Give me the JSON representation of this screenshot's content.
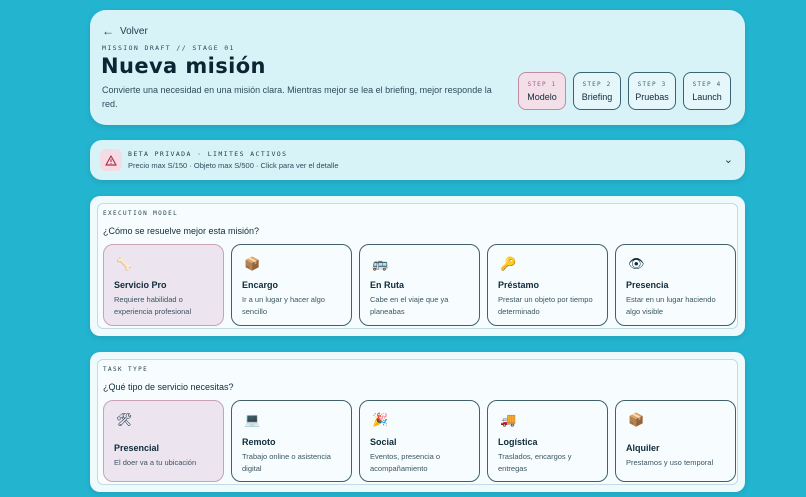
{
  "header": {
    "back_label": "Volver",
    "kicker": "MISSION DRAFT // STAGE 01",
    "title": "Nueva misión",
    "subtitle": "Convierte una necesidad en una misión clara. Mientras mejor se lea el briefing, mejor responde la red.",
    "steps": [
      {
        "number": "STEP 1",
        "label": "Modelo",
        "active": true
      },
      {
        "number": "STEP 2",
        "label": "Briefing",
        "active": false
      },
      {
        "number": "STEP 3",
        "label": "Pruebas",
        "active": false
      },
      {
        "number": "STEP 4",
        "label": "Launch",
        "active": false
      }
    ]
  },
  "beta": {
    "title": "BETA PRIVADA · LIMITES ACTIVOS",
    "description": "Precio max S/150 · Objeto max S/500 · Click para ver el detalle",
    "icon": "warning-icon"
  },
  "execution": {
    "label": "EXECUTION MODEL",
    "question": "¿Cómo se resuelve mejor esta misión?",
    "options": [
      {
        "icon": "bone-icon",
        "glyph": "🦴",
        "name": "Servicio Pro",
        "desc": "Requiere habilidad o experiencia profesional",
        "selected": true
      },
      {
        "icon": "package-icon",
        "glyph": "📦",
        "name": "Encargo",
        "desc": "Ir a un lugar y hacer algo sencillo",
        "selected": false
      },
      {
        "icon": "bus-icon",
        "glyph": "🚌",
        "name": "En Ruta",
        "desc": "Cabe en el viaje que ya planeabas",
        "selected": false
      },
      {
        "icon": "key-icon",
        "glyph": "🔑",
        "name": "Préstamo",
        "desc": "Prestar un objeto por tiempo determinado",
        "selected": false
      },
      {
        "icon": "eye-icon",
        "glyph": "👁",
        "name": "Presencia",
        "desc": "Estar en un lugar haciendo algo visible",
        "selected": false
      }
    ]
  },
  "task": {
    "label": "TASK TYPE",
    "question": "¿Qué tipo de servicio necesitas?",
    "options": [
      {
        "icon": "tools-icon",
        "glyph": "🛠",
        "name": "Presencial",
        "desc": "El doer va a tu ubicación",
        "selected": true
      },
      {
        "icon": "computer-icon",
        "glyph": "💻",
        "name": "Remoto",
        "desc": "Trabajo online o asistencia digital",
        "selected": false
      },
      {
        "icon": "party-icon",
        "glyph": "🎉",
        "name": "Social",
        "desc": "Eventos, presencia o acompañamiento",
        "selected": false
      },
      {
        "icon": "truck-icon",
        "glyph": "🚚",
        "name": "Logística",
        "desc": "Traslados, encargos y entregas",
        "selected": false
      },
      {
        "icon": "package-icon",
        "glyph": "📦",
        "name": "Alquiler",
        "desc": "Prestamos y uso temporal",
        "selected": false
      }
    ]
  },
  "colors": {
    "background": "#23b4d0",
    "card": "#d8f3f8",
    "selected": "#ece4ee",
    "active_step": "#f3dfe8"
  }
}
